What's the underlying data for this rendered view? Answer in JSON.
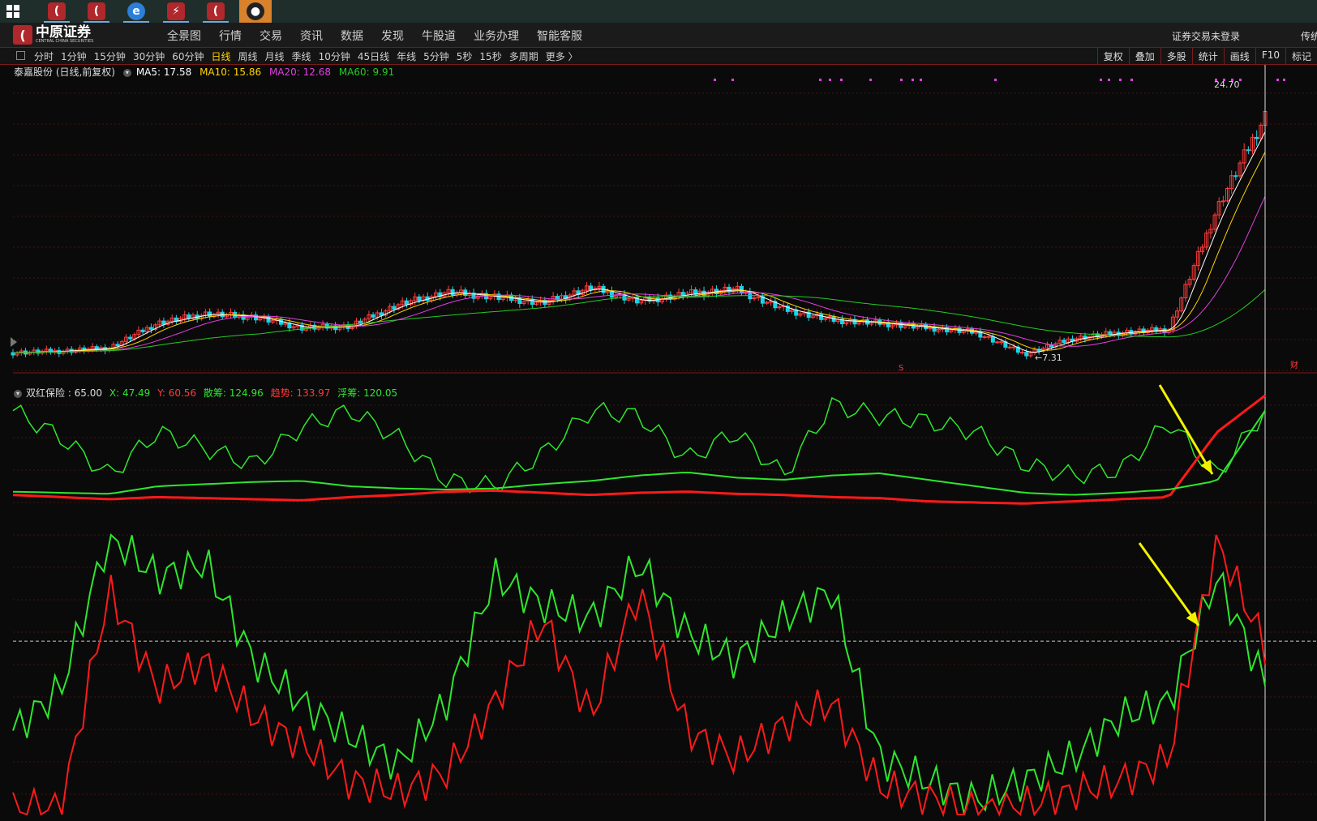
{
  "taskbar": {
    "apps": [
      {
        "name": "windows-start",
        "glyph": ""
      },
      {
        "name": "zhongyuan-app-1",
        "glyph": "("
      },
      {
        "name": "zhongyuan-app-2",
        "glyph": "("
      },
      {
        "name": "ie-browser",
        "glyph": "e"
      },
      {
        "name": "red-app",
        "glyph": "⚡"
      },
      {
        "name": "zhongyuan-app-3",
        "glyph": "("
      },
      {
        "name": "qq",
        "glyph": "●"
      }
    ]
  },
  "app": {
    "logo_cn": "中原证券",
    "logo_en": "CENTRAL CHINA SECURITIES",
    "menu": [
      "全景图",
      "行情",
      "交易",
      "资讯",
      "数据",
      "发现",
      "牛股道",
      "业务办理",
      "智能客服"
    ],
    "login_status": "证券交易未登录",
    "menu_extra": "传统"
  },
  "periods": {
    "items": [
      "分时",
      "1分钟",
      "15分钟",
      "30分钟",
      "60分钟",
      "日线",
      "周线",
      "月线",
      "季线",
      "10分钟",
      "45日线",
      "年线",
      "5分钟",
      "5秒",
      "15秒",
      "多周期",
      "更多 〉"
    ],
    "active": "日线"
  },
  "tools": [
    "复权",
    "叠加",
    "多股",
    "统计",
    "画线",
    "F10",
    "标记"
  ],
  "main_legend": {
    "stock": "泰嘉股份 (日线,前复权)",
    "ma5": "MA5: 17.58",
    "ma10": "MA10: 15.86",
    "ma20": "MA20: 12.68",
    "ma60": "MA60: 9.91"
  },
  "sub_legend": {
    "name": "双红保险 : 65.00",
    "x": "X: 47.49",
    "y": "Y: 60.56",
    "sanchou": "散筹: 124.96",
    "qushi": "趋势: 133.97",
    "fuchou": "浮筹: 120.05"
  },
  "annotations": {
    "high_label": "24.70",
    "low_label": "7.31",
    "marker_s": "S",
    "marker_fin": "财"
  },
  "colors": {
    "up": "#ff3b3b",
    "down": "#19d3e6",
    "ma5": "#ffffff",
    "ma10": "#ffd400",
    "ma20": "#e040e0",
    "ma60": "#22cc22",
    "green_line": "#2ee62e",
    "red_line": "#ff1a1a",
    "arrow": "#f2f200",
    "grid": "#4a1010"
  },
  "chart_data": [
    {
      "type": "candlestick",
      "title": "泰嘉股份 (日线,前复权)",
      "x": [
        0,
        20,
        40,
        60,
        80,
        100,
        120,
        140,
        160,
        180,
        200,
        220,
        240,
        260,
        280,
        300,
        320,
        340,
        360,
        380,
        400,
        420,
        440,
        460,
        480,
        500,
        520
      ],
      "close_series": {
        "name": "price",
        "values": [
          7.7,
          7.8,
          8.0,
          9.6,
          10.2,
          10.0,
          9.3,
          9.4,
          10.8,
          11.6,
          11.3,
          10.9,
          11.9,
          11.0,
          11.5,
          11.8,
          10.5,
          9.8,
          9.6,
          9.3,
          9.0,
          7.6,
          8.6,
          9.0,
          9.2,
          17.0,
          23.0
        ]
      },
      "low_annotation": {
        "label": "7.31"
      },
      "high_annotation": {
        "label": "24.70"
      }
    },
    {
      "type": "line",
      "title": "双红保险",
      "x": [
        0,
        20,
        40,
        60,
        80,
        100,
        120,
        140,
        160,
        180,
        200,
        220,
        240,
        260,
        280,
        300,
        320,
        340,
        360,
        380,
        400,
        420,
        440,
        460,
        480,
        500,
        520
      ],
      "series": [
        {
          "name": "散筹",
          "values": [
            120,
            95,
            60,
            100,
            85,
            70,
            105,
            120,
            95,
            55,
            50,
            80,
            120,
            115,
            75,
            100,
            60,
            125,
            115,
            110,
            100,
            70,
            60,
            65,
            110,
            60,
            120
          ]
        },
        {
          "name": "趋势",
          "values": [
            42,
            40,
            38,
            40,
            39,
            38,
            37,
            40,
            42,
            45,
            46,
            44,
            42,
            44,
            45,
            43,
            42,
            40,
            39,
            36,
            35,
            34,
            36,
            38,
            40,
            100,
            134
          ]
        },
        {
          "name": "浮筹",
          "values": [
            45,
            44,
            43,
            50,
            52,
            54,
            55,
            50,
            48,
            47,
            48,
            52,
            55,
            60,
            63,
            58,
            56,
            60,
            62,
            56,
            50,
            44,
            42,
            44,
            47,
            55,
            120
          ]
        }
      ]
    },
    {
      "type": "line",
      "x": [
        0,
        20,
        40,
        60,
        80,
        100,
        120,
        140,
        160,
        180,
        200,
        220,
        240,
        260,
        280,
        300,
        320,
        340,
        360,
        380,
        400,
        420,
        440,
        460,
        480,
        500,
        520
      ],
      "series": [
        {
          "name": "X",
          "values": [
            30,
            45,
            100,
            85,
            90,
            55,
            40,
            28,
            18,
            40,
            85,
            75,
            70,
            90,
            65,
            55,
            70,
            80,
            20,
            12,
            5,
            12,
            20,
            35,
            40,
            85,
            47
          ]
        },
        {
          "name": "Y",
          "values": [
            2,
            2,
            80,
            45,
            55,
            35,
            25,
            12,
            8,
            15,
            40,
            70,
            35,
            80,
            30,
            20,
            32,
            40,
            10,
            6,
            1,
            3,
            8,
            12,
            20,
            98,
            60
          ]
        }
      ],
      "reference_line": 62
    }
  ]
}
